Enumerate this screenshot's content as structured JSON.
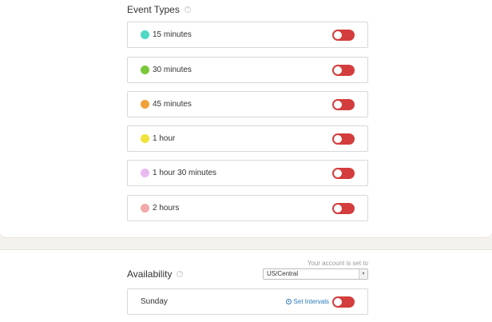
{
  "event_types": {
    "title": "Event Types",
    "help_icon": "question-circle-icon",
    "items": [
      {
        "label": "15 minutes",
        "color": "#4fd8c4"
      },
      {
        "label": "30 minutes",
        "color": "#7ac83a"
      },
      {
        "label": "45 minutes",
        "color": "#f1a13a"
      },
      {
        "label": "1 hour",
        "color": "#f1e23a"
      },
      {
        "label": "1 hour 30 minutes",
        "color": "#e9b9f0"
      },
      {
        "label": "2 hours",
        "color": "#f2aaa8"
      }
    ]
  },
  "availability": {
    "title": "Availability",
    "help_icon": "question-circle-icon",
    "timezone_caption": "Your account is set to",
    "timezone_value": "US/Central",
    "days": [
      {
        "label": "Sunday",
        "set_intervals_label": "Set Intervals"
      }
    ]
  },
  "colors": {
    "toggle_off": "#d33d3d",
    "link": "#2a7ab8"
  }
}
